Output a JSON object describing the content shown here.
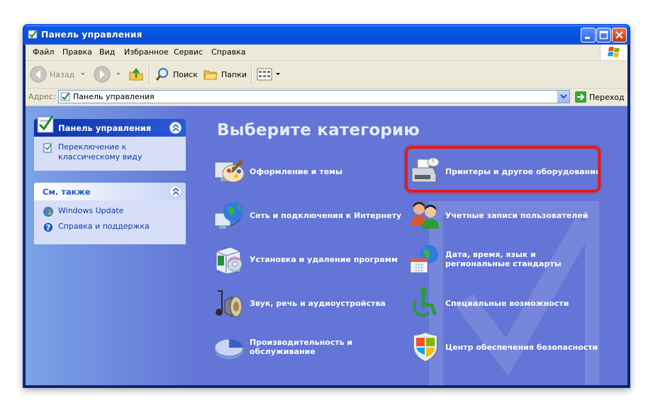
{
  "window": {
    "title": "Панель управления"
  },
  "menu": [
    "Файл",
    "Правка",
    "Вид",
    "Избранное",
    "Сервис",
    "Справка"
  ],
  "toolbar": {
    "back_label": "Назад",
    "search_label": "Поиск",
    "folders_label": "Папки"
  },
  "address": {
    "label": "Адрес:",
    "value": "Панель управления",
    "go_label": "Переход"
  },
  "taskpane": {
    "primary_title": "Панель управления",
    "primary_link": "Переключение к классическому виду",
    "see_also_title": "См. также",
    "see_also_links": [
      "Windows Update",
      "Справка и поддержка"
    ]
  },
  "main": {
    "title": "Выберите категорию",
    "categories": [
      {
        "label": "Оформление и темы",
        "icon": "appearance-themes-icon"
      },
      {
        "label": "Принтеры и другое оборудование",
        "icon": "printer-icon",
        "highlighted": true
      },
      {
        "label": "Сеть и подключения к Интернету",
        "icon": "network-globe-icon"
      },
      {
        "label": "Учетные записи пользователей",
        "icon": "users-icon"
      },
      {
        "label": "Установка и удаление программ",
        "icon": "add-remove-programs-icon"
      },
      {
        "label": "Дата, время, язык и региональные стандарты",
        "icon": "date-time-globe-icon"
      },
      {
        "label": "Звук, речь и аудиоустройства",
        "icon": "speaker-icon"
      },
      {
        "label": "Специальные возможности",
        "icon": "accessibility-icon"
      },
      {
        "label": "Производительность и обслуживание",
        "icon": "performance-pie-icon"
      },
      {
        "label": "Центр обеспечения безопасности",
        "icon": "security-shield-icon"
      }
    ]
  },
  "colors": {
    "content_bg": "#6375d6",
    "title_bar": "#0553e2",
    "highlight": "#e31d1d"
  }
}
